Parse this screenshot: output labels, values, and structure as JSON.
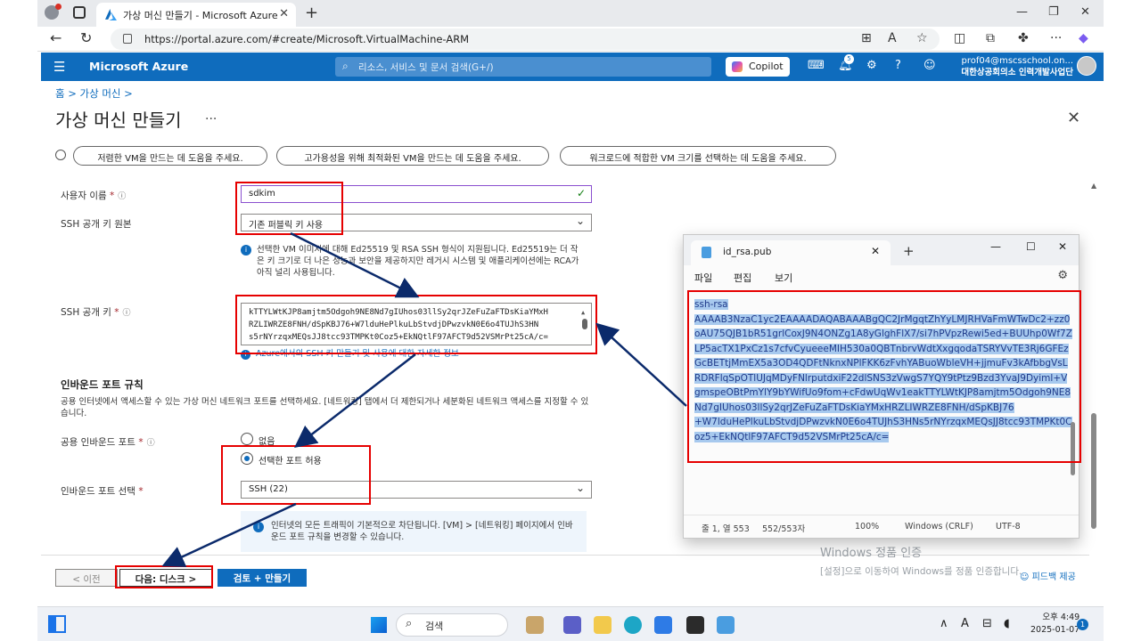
{
  "browser": {
    "tab_title": "가상 머신 만들기 - Microsoft Azure",
    "url": "https://portal.azure.com/#create/Microsoft.VirtualMachine-ARM"
  },
  "azure": {
    "brand": "Microsoft Azure",
    "search_placeholder": "리소스, 서비스 및 문서 검색(G+/)",
    "copilot": "Copilot",
    "notif_count": "5",
    "account_email": "prof04@mscsschool.on...",
    "account_org": "대한상공회의소 인력개발사업단"
  },
  "page": {
    "breadcrumb": "홈 > 가상 머신 >",
    "title": "가상 머신 만들기",
    "more": "...",
    "chips": [
      "저렴한 VM을 만드는 데 도움을 주세요.",
      "고가용성을 위해 최적화된 VM을 만드는 데 도움을 주세요.",
      "워크로드에 적합한 VM 크기를 선택하는 데 도움을 주세요."
    ]
  },
  "form": {
    "username_label": "사용자 이름",
    "username_value": "sdkim",
    "ssh_source_label": "SSH 공개 키 원본",
    "ssh_source_value": "기존 퍼블릭 키 사용",
    "ssh_info": "선택한 VM 이미지에 대해 Ed25519 및 RSA SSH 형식이 지원됩니다. Ed25519는 더 작은 키 크기로 더 나은 성능과 보안을 제공하지만 레거시 시스템 및 애플리케이션에는 RCA가 아직 널리 사용됩니다.",
    "ssh_key_label": "SSH 공개 키",
    "ssh_key_lines": [
      "kTTYLWtKJP8amjtm5Odgoh9NE8Nd7gIUhos03llSy2qrJZeFuZaFTDsKiaYMxH",
      "RZLIWRZE8FNH/dSpKBJ76+W7lduHePlkuLbStvdjDPwzvkN0E6o4TUJhS3HN",
      "s5rNYrzqxMEQsJJ8tcc93TMPKt0Coz5+EkNQtlF97AFCT9d52VSMrPt25cA/c="
    ],
    "ssh_key_link": "Azure에서의 SSH 키 만들기 및 사용에 대한 자세한 정보",
    "inbound_title": "인바운드 포트 규칙",
    "inbound_desc": "공용 인터넷에서 액세스할 수 있는 가상 머신 네트워크 포트를 선택하세요. [네트워킹] 탭에서 더 제한되거나 세분화된 네트워크 액세스를 지정할 수 있습니다.",
    "public_inbound_label": "공용 인바운드 포트",
    "radio_none": "없음",
    "radio_allow": "선택한 포트 허용",
    "inbound_select_label": "인바운드 포트 선택",
    "inbound_select_value": "SSH (22)",
    "inbound_info": "인터넷의 모든 트래픽이 기본적으로 차단됩니다. [VM] > [네트워킹] 페이지에서 인바운드 포트 규칙을 변경할 수 있습니다."
  },
  "footer": {
    "prev": "< 이전",
    "next": "다음: 디스크 >",
    "create": "검토 + 만들기",
    "feedback": "피드백 제공",
    "win_activate_1": "Windows 정품 인증",
    "win_activate_2": "[설정]으로 이동하여 Windows를 정품 인증합니다."
  },
  "notepad": {
    "tab_title": "id_rsa.pub",
    "menu": [
      "파일",
      "편집",
      "보기"
    ],
    "content_line1": "ssh-rsa",
    "content_body": "AAAAB3NzaC1yc2EAAAADAQABAAABgQC2JrMgqtZhYyLMJRHVaFmWTwDc2+zz0oAU75QJB1bR51grlCoxJ9N4ONZg1A8yGlghFlX7/si7hPVpzRewi5ed+BUUhp0Wf7ZLP5acTX1PxCz1s7cfvCyueeeMIH530a0QBTnbrvWdtXxgqodaTSRYVvTE3Rj6GFEzGcBETtjMmEX5a3OD4QDFtNknxNPlFKK6zFvhYABuoWbleVH+jjmuFv3kAfbbgVsLRDRFlqSpOTlUJqMDyFNlrputdxiF22dlSNS3zVwgS7YQY9tPtz9Bzd3YvaJ9Dyiml+VgmspeOBtPmYlY9bYWifUo9fom+cFdwUqWv1eakTTYLWtKJP8amjtm5Odgoh9NE8Nd7gIUhos03llSy2qrJZeFuZaFTDsKiaYMxHRZLIWRZE8FNH/dSpKBJ76",
    "content_tail": "+W7lduHePlkuLbStvdjDPwzvkN0E6o4TUJhS3HNs5rNYrzqxMEQsJJ8tcc93TMPKt0Coz5+EkNQtlF97AFCT9d52VSMrPt25cA/c=",
    "status_pos": "줄 1, 열 553",
    "status_chars": "552/553자",
    "status_zoom": "100%",
    "status_eol": "Windows (CRLF)",
    "status_enc": "UTF-8"
  },
  "taskbar": {
    "search": "검색",
    "time": "오후 4:49",
    "date": "2025-01-07",
    "notif": "1",
    "lang": "A"
  },
  "colors": {
    "azure_blue": "#0f6cbd",
    "annotation_red": "#e60000",
    "arrow_navy": "#0b2a6b"
  }
}
